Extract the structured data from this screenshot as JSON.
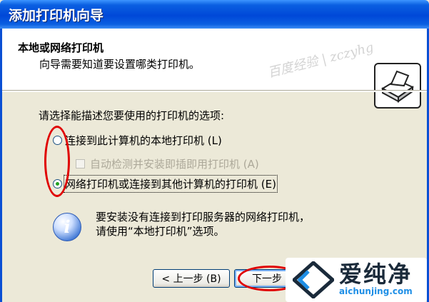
{
  "window": {
    "title": "添加打印机向导"
  },
  "header": {
    "title": "本地或网络打印机",
    "subtitle": "向导需要知道要设置哪类打印机。",
    "watermark": "百度经验 | zczyhg"
  },
  "content": {
    "instruction": "请选择能描述您要使用的打印机的选项:",
    "options": [
      {
        "label": "连接到此计算机的本地打印机 (L)",
        "selected": false
      },
      {
        "label": "网络打印机或连接到其他计算机的打印机 (E)",
        "selected": true
      }
    ],
    "auto_detect": {
      "label": "自动检测并安装即插即用打印机 (A)",
      "enabled": false,
      "checked": false
    },
    "info_line1": "要安装没有连接到打印服务器的网络打印机，",
    "info_line2": "请使用“本地打印机”选项。"
  },
  "buttons": {
    "back": "< 上一步 (B)",
    "next": "下一步"
  },
  "colors": {
    "titlebar": "#0a5fe1",
    "annotation": "#e00000",
    "radio_dot": "#21a121"
  },
  "logo": {
    "name": "爱纯净",
    "url": "aichunjing.com"
  }
}
